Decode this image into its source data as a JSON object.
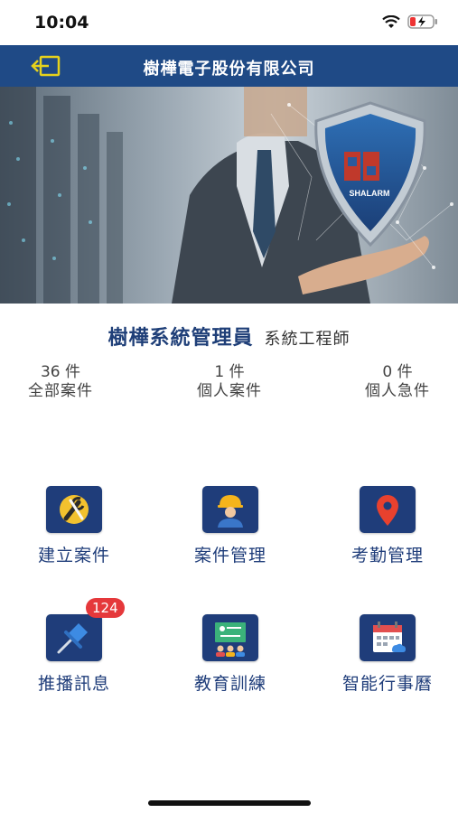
{
  "status": {
    "time": "10:04"
  },
  "header": {
    "title": "樹樺電子股份有限公司"
  },
  "banner": {
    "shield_text": "SHALARM",
    "shield_logo": "96"
  },
  "user": {
    "name": "樹樺系統管理員",
    "role": "系統工程師"
  },
  "stats": [
    {
      "value": "36  件",
      "label": "全部案件"
    },
    {
      "value": "1  件",
      "label": "個人案件"
    },
    {
      "value": "0  件",
      "label": "個人急件"
    }
  ],
  "menu": [
    {
      "label": "建立案件",
      "icon": "tools-icon"
    },
    {
      "label": "案件管理",
      "icon": "worker-icon"
    },
    {
      "label": "考勤管理",
      "icon": "location-pin-icon"
    },
    {
      "label": "推播訊息",
      "icon": "push-pin-icon",
      "badge": "124"
    },
    {
      "label": "教育訓練",
      "icon": "classroom-icon"
    },
    {
      "label": "智能行事曆",
      "icon": "calendar-icon"
    }
  ],
  "colors": {
    "nav": "#1f4a86",
    "accent": "#1f3d7a",
    "badge": "#e5383b"
  }
}
